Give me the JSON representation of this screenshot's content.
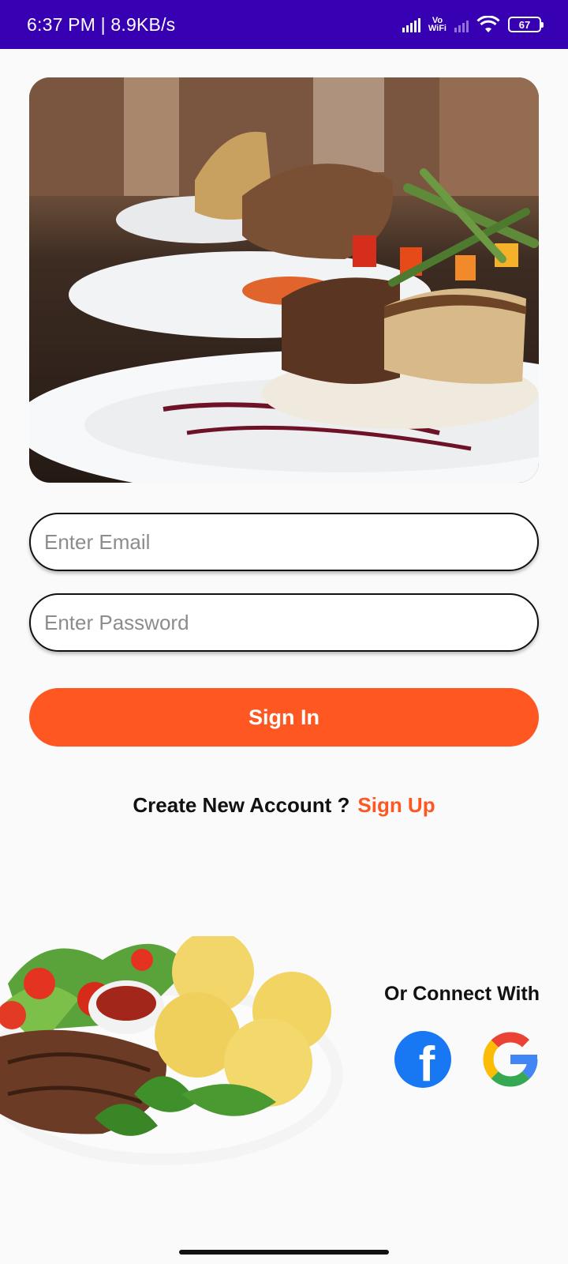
{
  "status_bar": {
    "time_speed": "6:37 PM | 8.9KB/s",
    "vowifi_top": "Vo",
    "vowifi_bottom": "WiFi",
    "battery": "67"
  },
  "login": {
    "email_placeholder": "Enter Email",
    "password_placeholder": "Enter Password",
    "signin_label": "Sign In",
    "create_account_label": "Create New Account ?",
    "signup_label": "Sign Up"
  },
  "social": {
    "label": "Or Connect With",
    "facebook_letter": "f"
  },
  "colors": {
    "status_bar": "#3700b3",
    "accent": "#ff5722",
    "facebook": "#1877f2"
  }
}
